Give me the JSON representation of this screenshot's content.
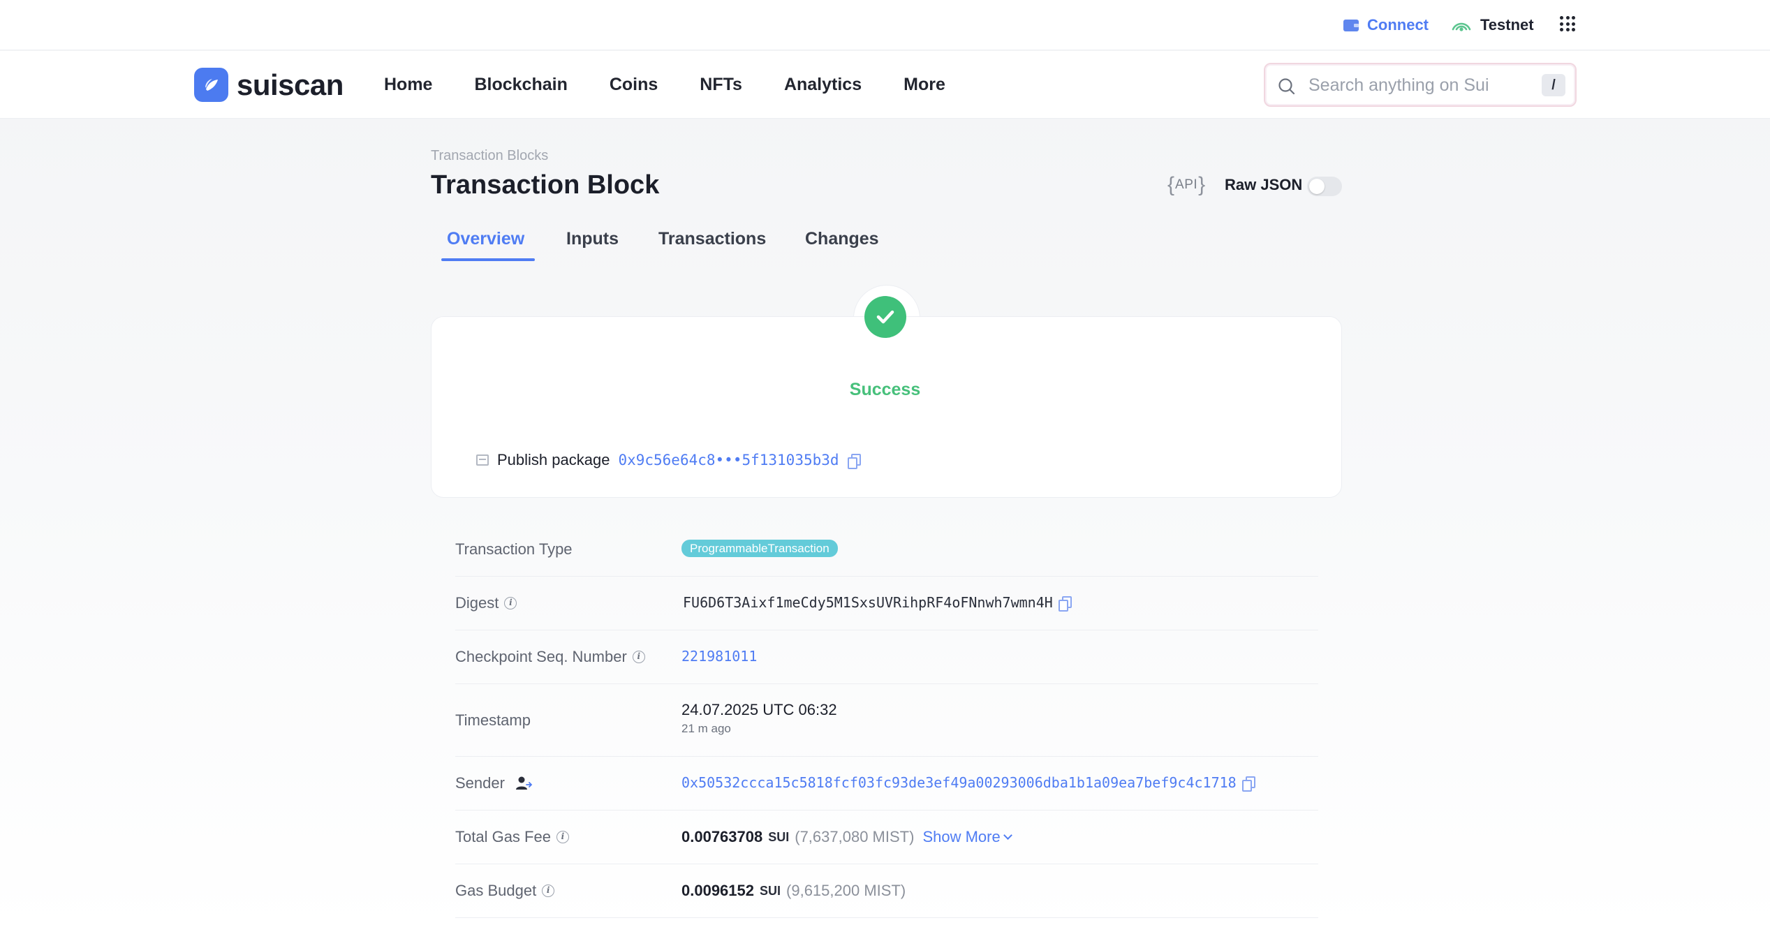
{
  "topbar": {
    "connect_label": "Connect",
    "network_label": "Testnet"
  },
  "nav": {
    "logo_text": "suiscan",
    "items": [
      "Home",
      "Blockchain",
      "Coins",
      "NFTs",
      "Analytics",
      "More"
    ],
    "search_placeholder": "Search anything on Sui",
    "search_shortcut": "/"
  },
  "header": {
    "breadcrumb": "Transaction Blocks",
    "title": "Transaction Block",
    "api_label": "API",
    "raw_json_label": "Raw JSON"
  },
  "tabs": [
    {
      "label": "Overview",
      "active": true
    },
    {
      "label": "Inputs",
      "active": false
    },
    {
      "label": "Transactions",
      "active": false
    },
    {
      "label": "Changes",
      "active": false
    }
  ],
  "status": {
    "label": "Success",
    "publish_label": "Publish package",
    "package_id": "0x9c56e64c8•••5f131035b3d"
  },
  "details": {
    "tx_type_label": "Transaction Type",
    "tx_type_value": "ProgrammableTransaction",
    "digest_label": "Digest",
    "digest_value": "FU6D6T3Aixf1meCdy5M1SxsUVRihpRF4oFNnwh7wmn4H",
    "checkpoint_label": "Checkpoint Seq. Number",
    "checkpoint_value": "221981011",
    "timestamp_label": "Timestamp",
    "timestamp_value": "24.07.2025 UTC 06:32",
    "timestamp_relative": "21 m ago",
    "sender_label": "Sender",
    "sender_value": "0x50532ccca15c5818fcf03fc93de3ef49a00293006dba1b1a09ea7bef9c4c1718",
    "gas_fee_label": "Total Gas Fee",
    "gas_fee_value": "0.00763708",
    "gas_fee_unit": "SUI",
    "gas_fee_mist": "(7,637,080 MIST)",
    "show_more_label": "Show More",
    "gas_budget_label": "Gas Budget",
    "gas_budget_value": "0.0096152",
    "gas_budget_unit": "SUI",
    "gas_budget_mist": "(9,615,200 MIST)"
  },
  "colors": {
    "accent": "#4f7cf3",
    "success": "#47c07b",
    "badge": "#63cbd9"
  }
}
